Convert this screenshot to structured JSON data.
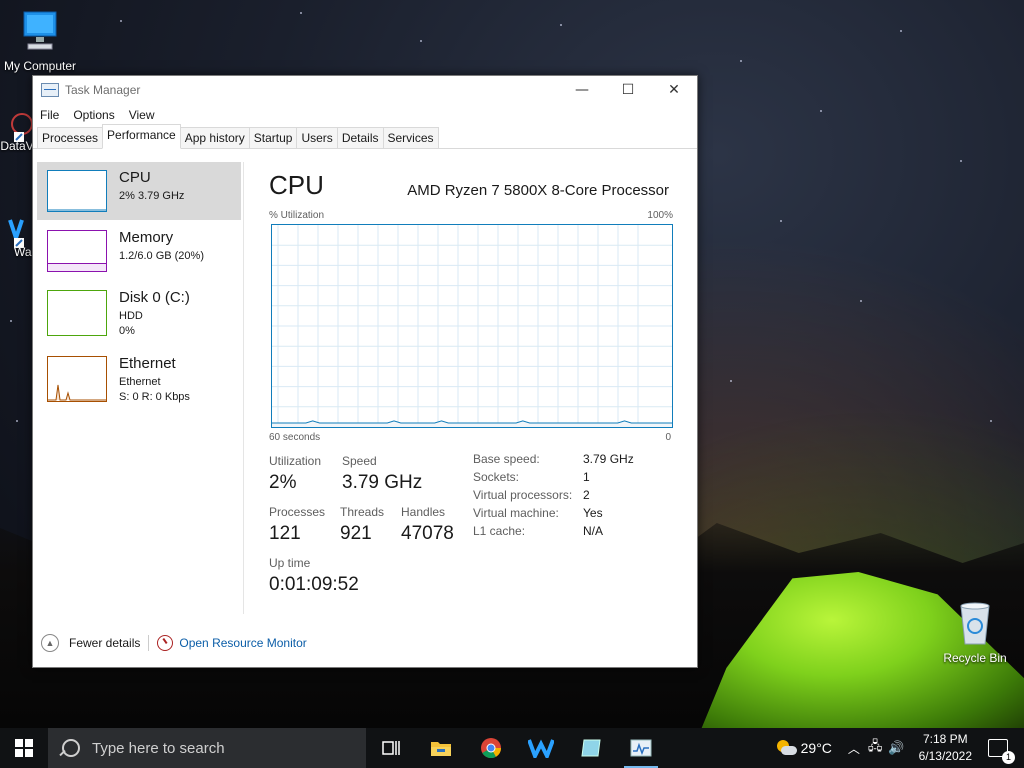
{
  "desktop": {
    "icons": [
      {
        "label": "My Computer"
      },
      {
        "label": "DataV"
      },
      {
        "label": "Wa"
      },
      {
        "label": "Recycle Bin"
      }
    ]
  },
  "window": {
    "title": "Task Manager",
    "controls": {
      "minimize": "—",
      "maximize": "☐",
      "close": "✕"
    },
    "menu": [
      "File",
      "Options",
      "View"
    ],
    "tabs": [
      "Processes",
      "Performance",
      "App history",
      "Startup",
      "Users",
      "Details",
      "Services"
    ],
    "active_tab": "Performance"
  },
  "resources": [
    {
      "name": "CPU",
      "sub1": "2% 3.79 GHz",
      "sub2": "",
      "color": "#117dbb",
      "selected": true
    },
    {
      "name": "Memory",
      "sub1": "1.2/6.0 GB (20%)",
      "sub2": "",
      "color": "#8b12ae"
    },
    {
      "name": "Disk 0 (C:)",
      "sub1": "HDD",
      "sub2": "0%",
      "color": "#4da60c"
    },
    {
      "name": "Ethernet",
      "sub1": "Ethernet",
      "sub2": "S: 0 R: 0 Kbps",
      "color": "#a74f01"
    }
  ],
  "cpu": {
    "title": "CPU",
    "processor": "AMD Ryzen 7 5800X 8-Core Processor",
    "utilization_label": "% Utilization",
    "max_label": "100%",
    "time_label": "60 seconds",
    "zero_label": "0",
    "stats": {
      "utilization": {
        "label": "Utilization",
        "value": "2%"
      },
      "speed": {
        "label": "Speed",
        "value": "3.79 GHz"
      },
      "processes": {
        "label": "Processes",
        "value": "121"
      },
      "threads": {
        "label": "Threads",
        "value": "921"
      },
      "handles": {
        "label": "Handles",
        "value": "47078"
      },
      "uptime": {
        "label": "Up time",
        "value": "0:01:09:52"
      }
    },
    "specs": [
      {
        "k": "Base speed:",
        "v": "3.79 GHz"
      },
      {
        "k": "Sockets:",
        "v": "1"
      },
      {
        "k": "Virtual processors:",
        "v": "2"
      },
      {
        "k": "Virtual machine:",
        "v": "Yes"
      },
      {
        "k": "L1 cache:",
        "v": "N/A"
      }
    ],
    "graph_series_percent": [
      2,
      2,
      2,
      2,
      2,
      2,
      3,
      2,
      2,
      2,
      2,
      2,
      2,
      2,
      2,
      2,
      2,
      2,
      3,
      2,
      2,
      2,
      2,
      2,
      2,
      3,
      2,
      2,
      2,
      2,
      2,
      2,
      2,
      2,
      2,
      2,
      2,
      3,
      2,
      2,
      2,
      2,
      2,
      2,
      2,
      2,
      2,
      2,
      2,
      2,
      2,
      2,
      3,
      2,
      2,
      2,
      2,
      2,
      2,
      2
    ]
  },
  "footer": {
    "fewer_details": "Fewer details",
    "open_rm": "Open Resource Monitor"
  },
  "taskbar": {
    "search_placeholder": "Type here to search",
    "weather": "29°C",
    "time": "7:18 PM",
    "date": "6/13/2022",
    "notification_count": "1"
  }
}
